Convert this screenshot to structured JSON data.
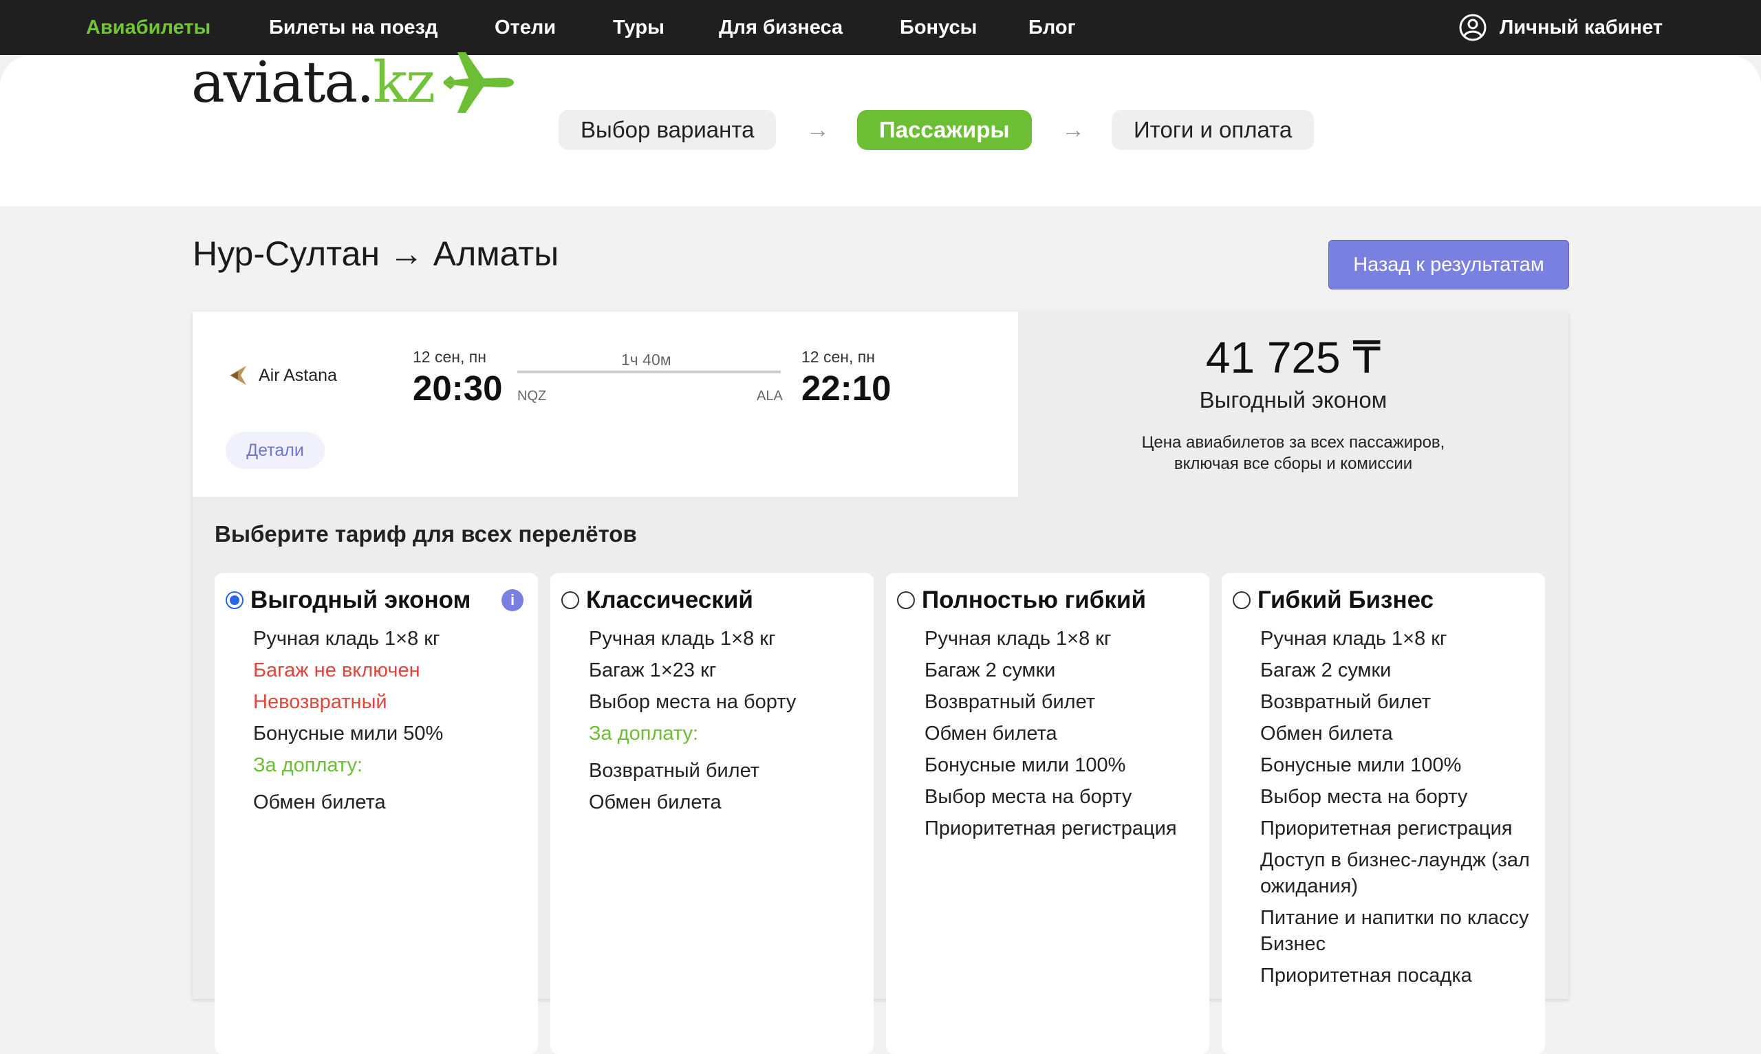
{
  "nav": {
    "items": [
      "Авиабилеты",
      "Билеты на поезд",
      "Отели",
      "Туры",
      "Для бизнеса",
      "Бонусы",
      "Блог"
    ],
    "cabinet": "Личный кабинет"
  },
  "logo": {
    "main": "aviata.",
    "tld": "kz"
  },
  "steps": [
    "Выбор варианта",
    "Пассажиры",
    "Итоги и оплата"
  ],
  "route_title": "Нур-Султан → Алматы",
  "back_button": "Назад к результатам",
  "flight": {
    "airline": "Air Astana",
    "dep_date": "12 сен, пн",
    "dep_time": "20:30",
    "dep_code": "NQZ",
    "duration": "1ч 40м",
    "arr_date": "12 сен, пн",
    "arr_time": "22:10",
    "arr_code": "ALA",
    "details": "Детали"
  },
  "price": {
    "amount": "41 725 ₸",
    "fare": "Выгодный эконом",
    "note_line1": "Цена авиабилетов за всех пассажиров,",
    "note_line2": "включая все сборы и комиссии"
  },
  "choose_title": "Выберите тариф для всех перелётов",
  "tariffs": [
    {
      "name": "Выгодный эконом",
      "features": [
        "Ручная кладь 1×8 кг",
        "Багаж не включен",
        "Невозвратный",
        "Бонусные мили 50%",
        "За доплату:",
        "Обмен билета"
      ]
    },
    {
      "name": "Классический",
      "features": [
        "Ручная кладь 1×8 кг",
        "Багаж 1×23 кг",
        "Выбор места на борту",
        "За доплату:",
        "Возвратный билет",
        "Обмен билета"
      ]
    },
    {
      "name": "Полностью гибкий",
      "features": [
        "Ручная кладь 1×8 кг",
        "Багаж 2 сумки",
        "Возвратный билет",
        "Обмен билета",
        "Бонусные мили 100%",
        "Выбор места на борту",
        "Приоритетная регистрация"
      ]
    },
    {
      "name": "Гибкий Бизнес",
      "features": [
        "Ручная кладь 1×8 кг",
        "Багаж 2 сумки",
        "Возвратный билет",
        "Обмен билета",
        "Бонусные мили 100%",
        "Выбор места на борту",
        "Приоритетная регистрация",
        "Доступ в бизнес-лаундж (зал ожидания)",
        "Питание и напитки по классу Бизнес",
        "Приоритетная посадка"
      ]
    }
  ],
  "colors": {
    "accent_green": "#6cbe35",
    "accent_purple": "#7a80e0",
    "warning_red": "#e0473b",
    "radio_blue": "#2a64e8"
  }
}
